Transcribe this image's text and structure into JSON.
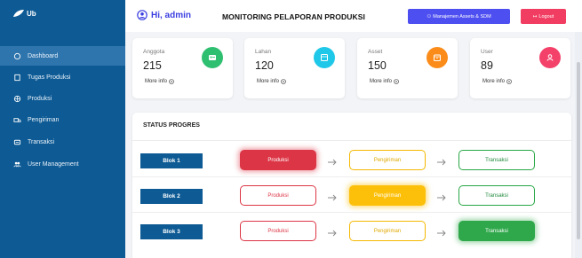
{
  "sidebar": {
    "logo": "Ub",
    "items": [
      {
        "label": "Dashboard",
        "icon": "home-icon",
        "active": true
      },
      {
        "label": "Tugas Produksi",
        "icon": "clipboard-icon",
        "active": false
      },
      {
        "label": "Produksi",
        "icon": "factory-icon",
        "active": false
      },
      {
        "label": "Pengiriman",
        "icon": "truck-icon",
        "active": false
      },
      {
        "label": "Transaksi",
        "icon": "receipt-icon",
        "active": false
      },
      {
        "label": "User Management",
        "icon": "users-icon",
        "active": false
      }
    ]
  },
  "header": {
    "greeting": "Hi, admin",
    "title": "MONITORING PELAPORAN PRODUKSI",
    "assets_button": "Manajemen Assets & SDM",
    "logout_button": "Logout"
  },
  "cards": [
    {
      "label": "Anggota",
      "value": "215",
      "more": "More info",
      "color": "#2fbf71",
      "icon": "user-card-icon"
    },
    {
      "label": "Lahan",
      "value": "120",
      "more": "More info",
      "color": "#1fc8e8",
      "icon": "map-icon"
    },
    {
      "label": "Asset",
      "value": "150",
      "more": "More info",
      "color": "#fb8c1a",
      "icon": "box-icon"
    },
    {
      "label": "User",
      "value": "89",
      "more": "More info",
      "color": "#f3416a",
      "icon": "user-icon"
    }
  ],
  "status": {
    "title": "STATUS PROGRES",
    "stages": [
      "Produksi",
      "Pengiriman",
      "Transaksi"
    ],
    "rows": [
      {
        "blok": "Blok 1",
        "active_stage": "Produksi"
      },
      {
        "blok": "Blok 2",
        "active_stage": "Pengiriman"
      },
      {
        "blok": "Blok 3",
        "active_stage": "Transaksi"
      }
    ]
  },
  "colors": {
    "sidebar_bg": "#0d5a94",
    "accent_blue": "#4e4ff0",
    "logout_red": "#f23d62"
  }
}
